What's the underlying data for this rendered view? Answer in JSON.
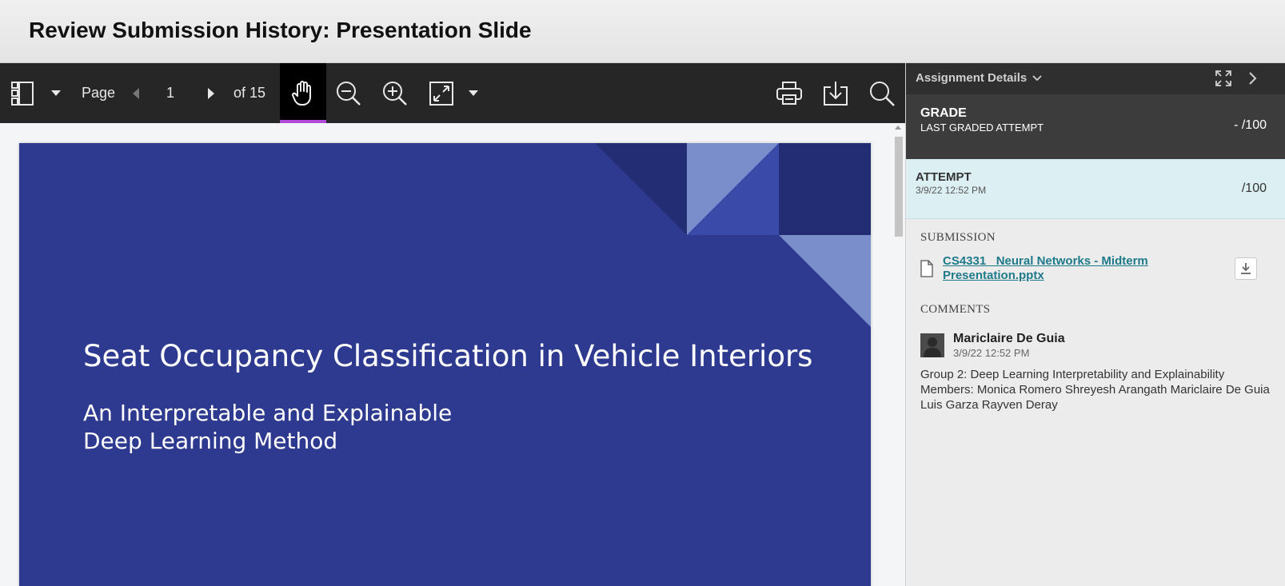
{
  "page": {
    "title": "Review Submission History: Presentation Slide"
  },
  "toolbar": {
    "page_label": "Page",
    "page_number": "1",
    "page_total": "of 15",
    "icons": [
      "sidebar-toggle-icon",
      "chevron-down-icon",
      "triangle-left-icon",
      "triangle-right-icon",
      "hand-pan-icon",
      "zoom-out-icon",
      "zoom-in-icon",
      "fit-page-icon",
      "chevron-down-icon",
      "print-icon",
      "download-icon",
      "search-icon"
    ],
    "active_tool_color": "#b04ad8"
  },
  "slide": {
    "title": "Seat Occupancy Classification in Vehicle Interiors",
    "subtitle": "An Interpretable and Explainable\nDeep Learning Method",
    "background_color": "#2d3a8f"
  },
  "panel": {
    "header_label": "Assignment Details",
    "grade": {
      "title": "GRADE",
      "subtitle": "LAST GRADED ATTEMPT",
      "score": "- /100"
    },
    "attempt": {
      "title": "ATTEMPT",
      "date": "3/9/22 12:52 PM",
      "score": "/100"
    },
    "submission": {
      "label": "SUBMISSION",
      "file_name": "CS4331_ Neural Networks - Midterm Presentation.pptx"
    },
    "comments": {
      "label": "COMMENTS",
      "author": "Mariclaire De Guia",
      "date": "3/9/22 12:52 PM",
      "body": "Group 2: Deep Learning Interpretability and Explainability Members: Monica Romero Shreyesh Arangath Mariclaire De Guia Luis Garza Rayven Deray"
    }
  }
}
